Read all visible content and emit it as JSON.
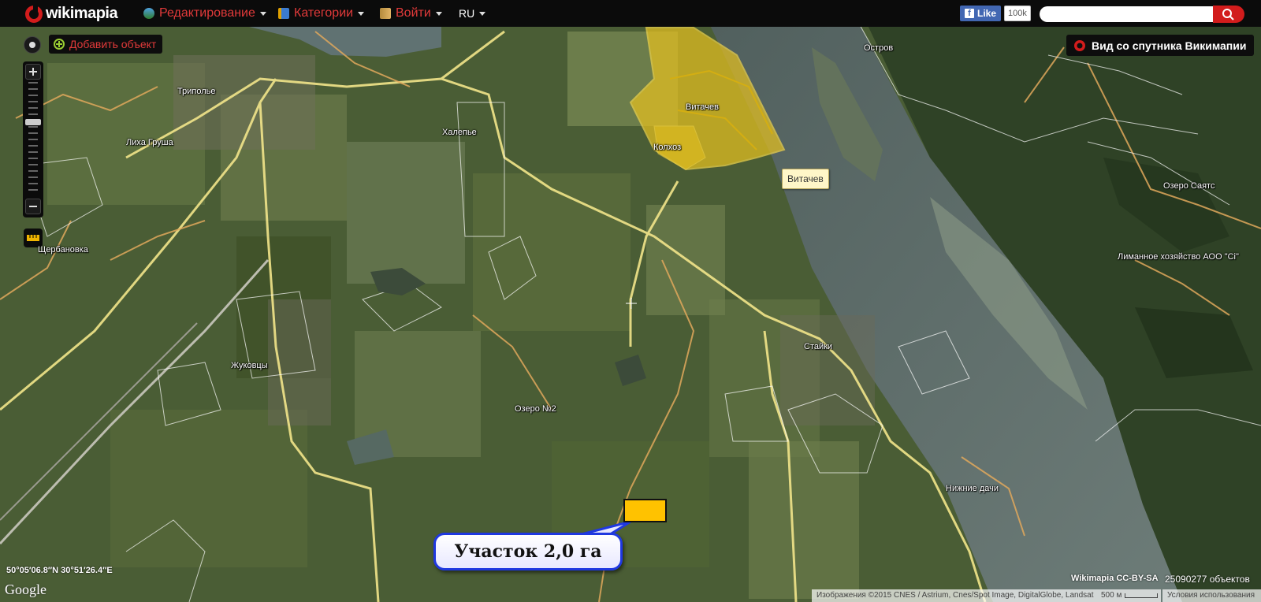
{
  "header": {
    "logo_text": "wikimapia",
    "menu": [
      {
        "label": "Редактирование",
        "icon": "globe-edit-icon"
      },
      {
        "label": "Категории",
        "icon": "categories-icon"
      },
      {
        "label": "Войти",
        "icon": "login-icon"
      }
    ],
    "language": "RU",
    "facebook": {
      "like_label": "Like",
      "count": "100k"
    },
    "search": {
      "placeholder": "",
      "value": ""
    }
  },
  "toolbar": {
    "add_object_label": "Добавить объект",
    "satellite_view_label": "Вид со спутника Викимапии"
  },
  "map": {
    "places": [
      "Остров",
      "Триполье",
      "Халепье",
      "Витачев",
      "Лиха Груша",
      "Колхоз",
      "Щербановка",
      "Озеро Саятс",
      "Лиманное хозяйство АОО \"Сі\"",
      "Стайки",
      "Жуковцы",
      "Озеро №2",
      "Нижние дачи"
    ],
    "tooltip": "Витачев",
    "callout_text": "Участок 2,0 га",
    "colors": {
      "highlight": "#e8c21f",
      "plot": "#ffc200",
      "callout_border": "#1f38e0"
    }
  },
  "footer": {
    "coordinates": "50°05′06.8″N 30°51′26.4″E",
    "google": "Google",
    "license": "Wikimapia CC-BY-SA",
    "object_count": "25090277 объектов",
    "imagery_attribution": "Изображения ©2015 CNES / Astrium, Cnes/Spot Image, DigitalGlobe, Landsat",
    "scale": "500 м",
    "terms": "Условия использования"
  }
}
